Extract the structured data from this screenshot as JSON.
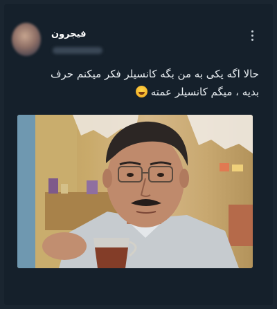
{
  "tweet": {
    "author": {
      "display_name": "فیجرون"
    },
    "text_line1": "حالا اگه یکی به من بگه کانسیلر فکر میکنم حرف",
    "text_line2": "بدیه ، میگم کانسیلر عمته",
    "emoji_icon": "rolling-laughing-emoji"
  },
  "colors": {
    "background": "#15202b",
    "text": "#e9eef2"
  }
}
